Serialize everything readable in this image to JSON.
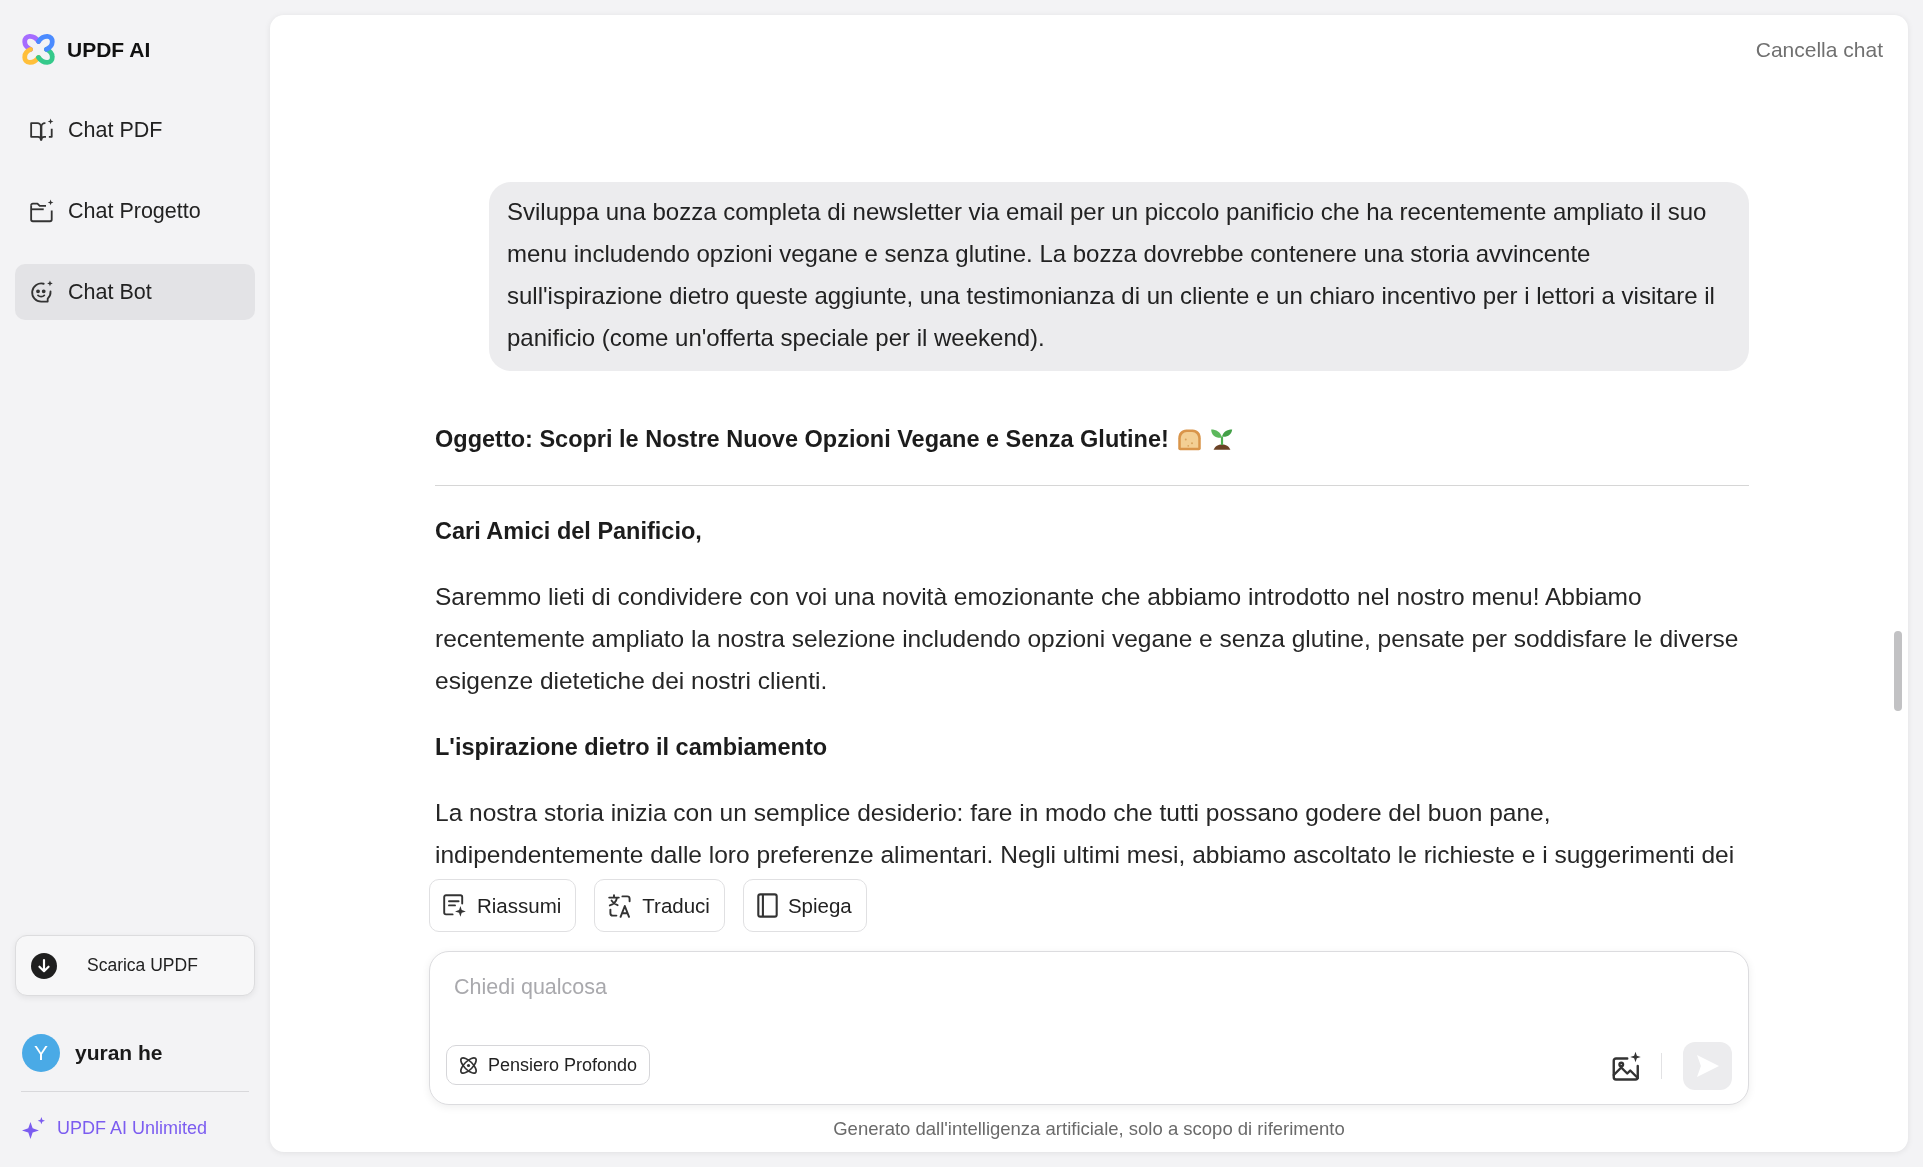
{
  "sidebar": {
    "app_name": "UPDF AI",
    "items": [
      {
        "label": "Chat PDF",
        "kind": "pdf",
        "selected": false
      },
      {
        "label": "Chat Progetto",
        "kind": "project",
        "selected": false
      },
      {
        "label": "Chat Bot",
        "kind": "bot",
        "selected": true
      }
    ],
    "download_button": "Scarica UPDF",
    "user": {
      "initial": "Y",
      "name": "yuran he"
    },
    "plan_link": "UPDF AI Unlimited"
  },
  "header": {
    "clear_chat": "Cancella chat"
  },
  "conversation": [
    {
      "kind": "prompt",
      "text": "Sviluppa una bozza completa di newsletter via email per un piccolo panificio che ha recentemente ampliato il suo menu includendo opzioni vegane e senza glutine. La bozza dovrebbe contenere una storia avvincente sull'ispirazione dietro queste aggiunte, una testimonianza di un cliente e un chiaro incentivo per i lettori a visitare il panificio (come un'offerta speciale per il weekend)."
    },
    {
      "kind": "reply",
      "blocks": [
        {
          "kind": "subject",
          "text": "Oggetto: Scopri le Nostre Nuove Opzioni Vegane e Senza Glutine!"
        },
        {
          "kind": "rule"
        },
        {
          "kind": "heading",
          "text": "Cari Amici del Panificio,"
        },
        {
          "kind": "paragraph",
          "text": "Saremmo lieti di condividere con voi una novità emozionante che abbiamo introdotto nel nostro menu! Abbiamo recentemente ampliato la nostra selezione includendo opzioni vegane e senza glutine, pensate per soddisfare le diverse esigenze dietetiche dei nostri clienti."
        },
        {
          "kind": "heading",
          "text": "L'ispirazione dietro il cambiamento"
        },
        {
          "kind": "paragraph",
          "text": "La nostra storia inizia con un semplice desiderio: fare in modo che tutti possano godere del buon pane, indipendentemente dalle loro preferenze alimentari. Negli ultimi mesi, abbiamo ascoltato le richieste e i suggerimenti dei"
        }
      ]
    }
  ],
  "quick_actions": [
    {
      "label": "Riassumi",
      "kind": "summarize"
    },
    {
      "label": "Traduci",
      "kind": "translate"
    },
    {
      "label": "Spiega",
      "kind": "explain"
    }
  ],
  "composer": {
    "placeholder": "Chiedi qualcosa",
    "deep_think_button": "Pensiero Profondo",
    "send_button": {
      "disabled": true
    }
  },
  "footer_note": "Generato dall'intelligenza artificiale, solo a scopo di riferimento"
}
